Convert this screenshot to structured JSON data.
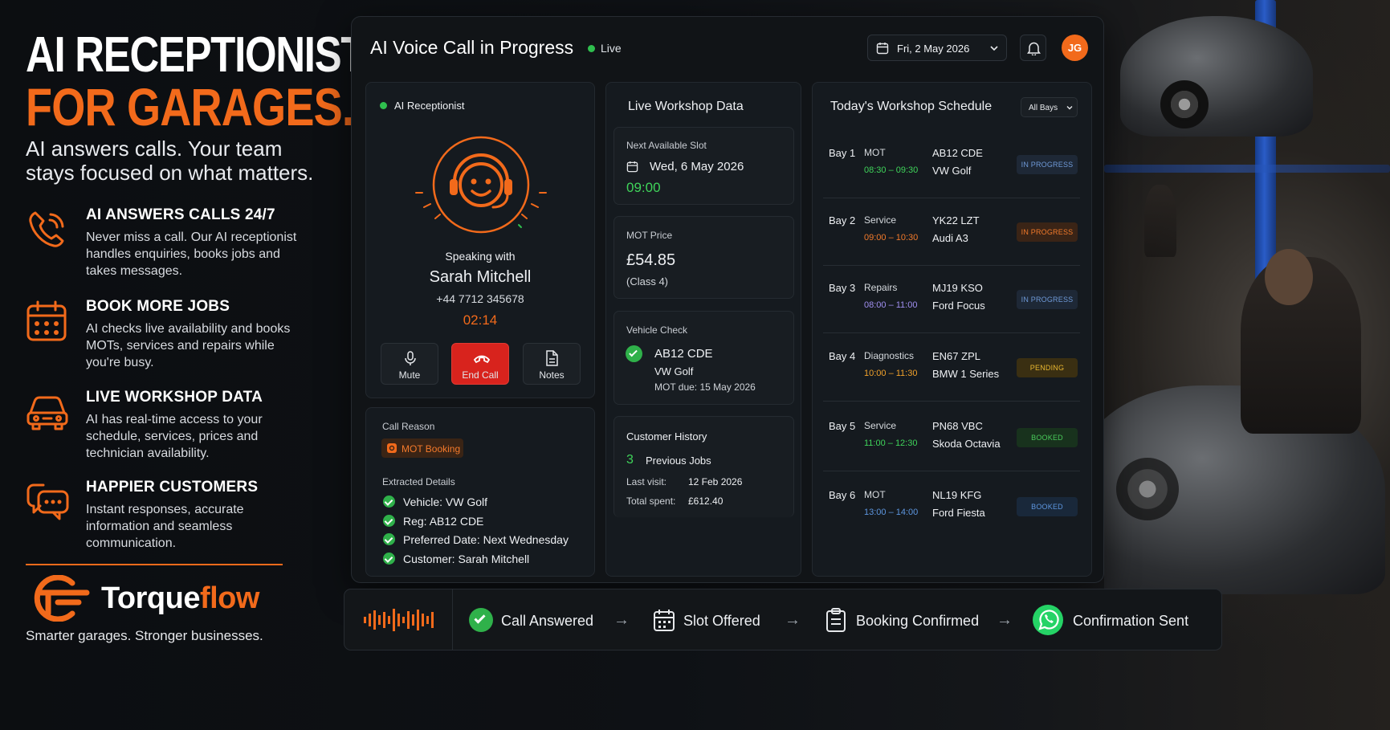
{
  "hero": {
    "line1": "AI RECEPTIONIST",
    "line2": "FOR GARAGES.",
    "subheading": "AI answers calls. Your team stays focused on what matters."
  },
  "features": [
    {
      "icon": "phone-ringing-icon",
      "title": "AI ANSWERS CALLS 24/7",
      "desc": "Never miss a call. Our AI receptionist handles enquiries, books jobs and takes messages."
    },
    {
      "icon": "calendar-icon",
      "title": "BOOK MORE JOBS",
      "desc": "AI checks live availability and books MOTs, services and repairs while you're busy."
    },
    {
      "icon": "car-icon",
      "title": "LIVE WORKSHOP DATA",
      "desc": "AI has real-time access to your schedule, services, prices and technician availability."
    },
    {
      "icon": "chat-bubbles-icon",
      "title": "HAPPIER CUSTOMERS",
      "desc": "Instant responses, accurate information and seamless communication."
    }
  ],
  "brand": {
    "name_a": "Torque",
    "name_b": "flow",
    "tagline": "Smarter garages. Stronger businesses."
  },
  "dashboard": {
    "title": "AI Voice Call in Progress",
    "status": "Live",
    "date": "Fri, 2 May 2026",
    "avatar": "JG"
  },
  "receptionist": {
    "label": "AI Receptionist",
    "speaking_with": "Speaking with",
    "caller_name": "Sarah Mitchell",
    "caller_phone": "+44 7712 345678",
    "duration": "02:14",
    "buttons": {
      "mute": "Mute",
      "end": "End Call",
      "notes": "Notes"
    }
  },
  "call_reason": {
    "label": "Call Reason",
    "reason": "MOT Booking",
    "extracted_label": "Extracted Details",
    "details": [
      "Vehicle: VW Golf",
      "Reg: AB12 CDE",
      "Preferred Date: Next Wednesday",
      "Customer: Sarah Mitchell"
    ]
  },
  "workshop": {
    "title": "Live Workshop Data",
    "slot_label": "Next Available Slot",
    "slot_date": "Wed, 6 May 2026",
    "slot_time": "09:00",
    "price_label": "MOT Price",
    "price": "£54.85",
    "price_class": "(Class 4)",
    "vehicle_label": "Vehicle Check",
    "vehicle_reg": "AB12 CDE",
    "vehicle_model": "VW Golf",
    "mot_due": "MOT due: 15 May 2026",
    "history_label": "Customer History",
    "previous_jobs_count": "3",
    "previous_jobs_label": "Previous Jobs",
    "last_visit_label": "Last visit:",
    "last_visit": "12 Feb 2026",
    "total_spent_label": "Total spent:",
    "total_spent": "£612.40"
  },
  "schedule": {
    "title": "Today's Workshop Schedule",
    "filter": "All Bays",
    "rows": [
      {
        "bay": "Bay 1",
        "service": "MOT",
        "time": "08:30 – 09:30",
        "time_color": "#3fd45a",
        "reg": "AB12 CDE",
        "vehicle": "VW Golf",
        "status": "IN PROGRESS"
      },
      {
        "bay": "Bay 2",
        "service": "Service",
        "time": "09:00 – 10:30",
        "time_color": "#f27a2b",
        "reg": "YK22 LZT",
        "vehicle": "Audi A3",
        "status": "IN PROGRESS"
      },
      {
        "bay": "Bay 3",
        "service": "Repairs",
        "time": "08:00 – 11:00",
        "time_color": "#a08ff0",
        "reg": "MJ19 KSO",
        "vehicle": "Ford Focus",
        "status": "IN PROGRESS"
      },
      {
        "bay": "Bay 4",
        "service": "Diagnostics",
        "time": "10:00 – 11:30",
        "time_color": "#f2a22b",
        "reg": "EN67 ZPL",
        "vehicle": "BMW 1 Series",
        "status": "PENDING"
      },
      {
        "bay": "Bay 5",
        "service": "Service",
        "time": "11:00 – 12:30",
        "time_color": "#3fd45a",
        "reg": "PN68 VBC",
        "vehicle": "Skoda Octavia",
        "status": "BOOKED"
      },
      {
        "bay": "Bay 6",
        "service": "MOT",
        "time": "13:00 – 14:00",
        "time_color": "#5d96df",
        "reg": "NL19 KFG",
        "vehicle": "Ford Fiesta",
        "status": "BOOKED"
      }
    ]
  },
  "flow": {
    "steps": [
      "Call Answered",
      "Slot Offered",
      "Booking Confirmed",
      "Confirmation Sent"
    ],
    "arrow": "→"
  },
  "colors": {
    "accent": "#f26a1b",
    "success": "#2fb14a",
    "background": "#0e1115",
    "panel": "#151a1f"
  }
}
